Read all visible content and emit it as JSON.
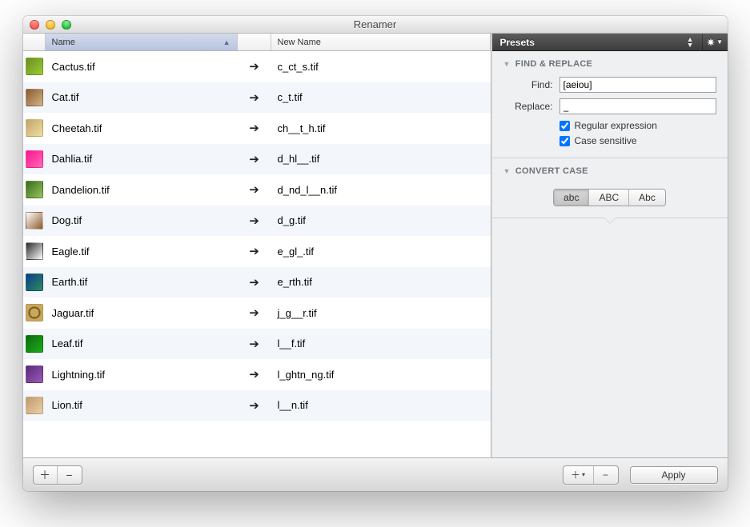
{
  "window": {
    "title": "Renamer"
  },
  "columns": {
    "name": "Name",
    "newname": "New Name"
  },
  "files": [
    {
      "name": "Cactus.tif",
      "newname": "c_ct_s.tif",
      "swatch": "linear-gradient(135deg,#6b8e23,#9acd32)"
    },
    {
      "name": "Cat.tif",
      "newname": "c_t.tif",
      "swatch": "linear-gradient(135deg,#8b5a2b,#d2b48c)"
    },
    {
      "name": "Cheetah.tif",
      "newname": "ch__t_h.tif",
      "swatch": "linear-gradient(135deg,#c2a36b,#f0e0a0)"
    },
    {
      "name": "Dahlia.tif",
      "newname": "d_hl__.tif",
      "swatch": "linear-gradient(135deg,#ff1493,#ff69b4)"
    },
    {
      "name": "Dandelion.tif",
      "newname": "d_nd_l__n.tif",
      "swatch": "linear-gradient(135deg,#3a6b1f,#97c35b)"
    },
    {
      "name": "Dog.tif",
      "newname": "d_g.tif",
      "swatch": "linear-gradient(135deg,#ffffff,#8b5a2b)"
    },
    {
      "name": "Eagle.tif",
      "newname": "e_gl_.tif",
      "swatch": "linear-gradient(135deg,#2b2b2b,#ffffff)"
    },
    {
      "name": "Earth.tif",
      "newname": "e_rth.tif",
      "swatch": "linear-gradient(135deg,#0b3d91,#2e8b57)"
    },
    {
      "name": "Jaguar.tif",
      "newname": "j_g__r.tif",
      "swatch": "radial-gradient(circle,#caa85a 40%,#4a3a12 41%,#caa85a 60%)"
    },
    {
      "name": "Leaf.tif",
      "newname": "l__f.tif",
      "swatch": "linear-gradient(135deg,#0a6b0a,#1faa1f)"
    },
    {
      "name": "Lightning.tif",
      "newname": "l_ghtn_ng.tif",
      "swatch": "linear-gradient(135deg,#5b2a7a,#9b59b6)"
    },
    {
      "name": "Lion.tif",
      "newname": "l__n.tif",
      "swatch": "linear-gradient(135deg,#c19a6b,#e8d0a9)"
    }
  ],
  "sidebar": {
    "presets_label": "Presets",
    "find_replace": {
      "heading": "FIND & REPLACE",
      "find_label": "Find:",
      "find_value": "[aeiou]",
      "replace_label": "Replace:",
      "replace_value": "_",
      "regex_label": "Regular expression",
      "regex_checked": true,
      "case_label": "Case sensitive",
      "case_checked": true
    },
    "convert_case": {
      "heading": "CONVERT CASE",
      "opts": [
        "abc",
        "ABC",
        "Abc"
      ],
      "active": 0
    }
  },
  "footer": {
    "apply": "Apply"
  }
}
